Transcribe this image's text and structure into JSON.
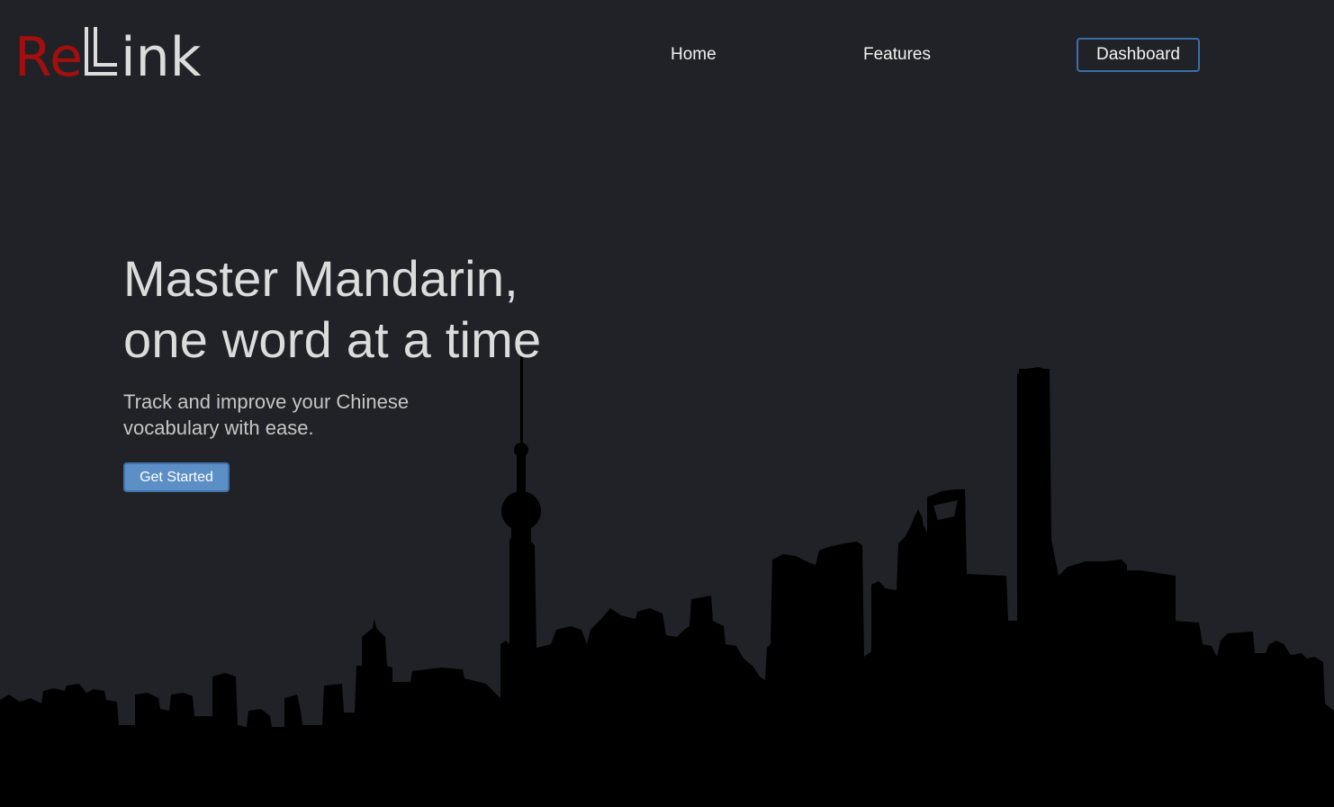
{
  "brand": {
    "logo_text": "ReLink",
    "logo_colors": {
      "re": "#a30f0f",
      "link": "#dcdcdc"
    }
  },
  "nav": {
    "items": [
      {
        "label": "Home"
      },
      {
        "label": "Features"
      },
      {
        "label": "Dashboard"
      }
    ]
  },
  "hero": {
    "title_line1": "Master Mandarin,",
    "title_line2": "one word at a time",
    "subtitle": "Track and improve your Chinese vocabulary with ease.",
    "cta_label": "Get Started",
    "background_image": "city-skyline-silhouette"
  },
  "colors": {
    "background": "#202227",
    "accent": "#5b8fc6",
    "dashboard_border": "#3d6fa8",
    "skyline": "#000000"
  }
}
